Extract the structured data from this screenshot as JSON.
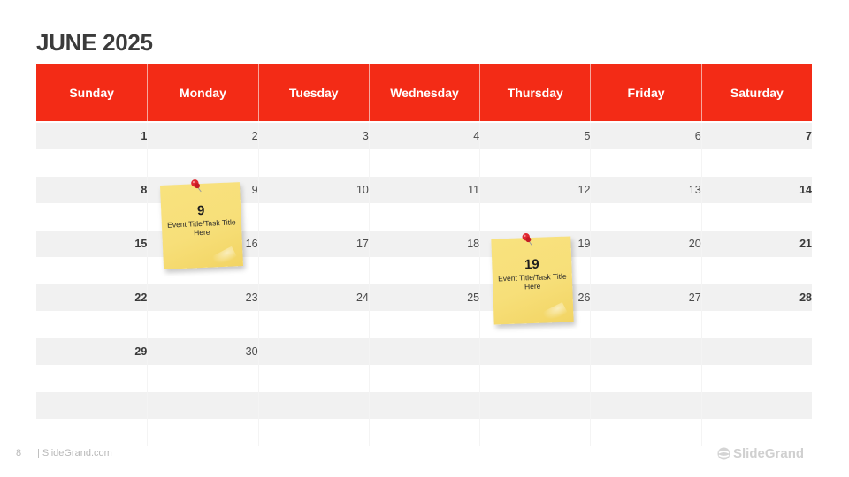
{
  "title": "JUNE 2025",
  "colors": {
    "header_bg": "#f32b16",
    "header_text": "#ffffff",
    "row_shade": "#f1f1f1",
    "sticky_note": "#f8e27e",
    "pin": "#e0262f"
  },
  "weekdays": [
    "Sunday",
    "Monday",
    "Tuesday",
    "Wednesday",
    "Thursday",
    "Friday",
    "Saturday"
  ],
  "weeks": [
    [
      "1",
      "2",
      "3",
      "4",
      "5",
      "6",
      "7"
    ],
    [
      "8",
      "9",
      "10",
      "11",
      "12",
      "13",
      "14"
    ],
    [
      "15",
      "16",
      "17",
      "18",
      "19",
      "20",
      "21"
    ],
    [
      "22",
      "23",
      "24",
      "25",
      "26",
      "27",
      "28"
    ],
    [
      "29",
      "30",
      "",
      "",
      "",
      "",
      ""
    ],
    [
      "",
      "",
      "",
      "",
      "",
      "",
      ""
    ]
  ],
  "notes": [
    {
      "day": "9",
      "text": "Event Title/Task Title Here",
      "icon": "pushpin-icon"
    },
    {
      "day": "19",
      "text": "Event Title/Task Title Here",
      "icon": "pushpin-icon"
    }
  ],
  "footer": {
    "page_number": "8",
    "site": "| SlideGrand.com",
    "brand": "SlideGrand",
    "brand_icon": "slidegrand-logo-icon"
  }
}
